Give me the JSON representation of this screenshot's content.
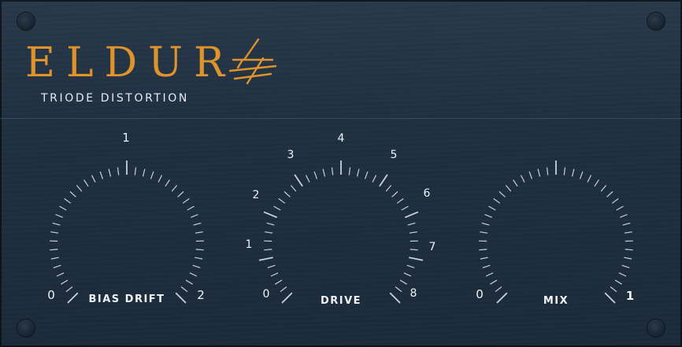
{
  "header": {
    "title": "ELDUR",
    "subtitle": "TRIODE DISTORTION",
    "logo_icon": "lightning-rune-icon",
    "accent_color": "#e0932a"
  },
  "knobs": [
    {
      "id": "bias-drift",
      "label": "BIAS DRIFT",
      "min_label": "0",
      "max_label": "2",
      "mid_label": "1",
      "scale_labels": [
        "0",
        "1",
        "2"
      ]
    },
    {
      "id": "drive",
      "label": "DRIVE",
      "scale_labels": [
        "0",
        "1",
        "2",
        "3",
        "4",
        "5",
        "6",
        "7",
        "8"
      ]
    },
    {
      "id": "mix",
      "label": "MIX",
      "scale_labels": [
        "0",
        "1"
      ]
    }
  ],
  "colors": {
    "panel": "#1e2f40",
    "ticks": "#c9d2da",
    "text": "#f0f3f6"
  }
}
